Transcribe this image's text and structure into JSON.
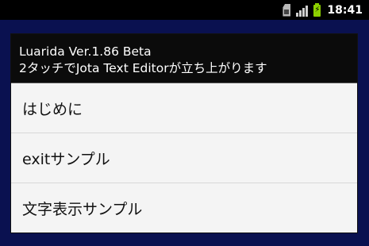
{
  "status_bar": {
    "time": "18:41",
    "icons": [
      "sim-card-icon",
      "signal-icon",
      "battery-charging-icon"
    ],
    "background": "#000000",
    "battery_color": "#8dd000"
  },
  "dialog": {
    "title_line1": "Luarida Ver.1.86 Beta",
    "title_line2": "2タッチでJota Text Editorが立ち上がります",
    "items": [
      {
        "label": "はじめに"
      },
      {
        "label": "exitサンプル"
      },
      {
        "label": "文字表示サンプル"
      }
    ]
  },
  "colors": {
    "background": "#0a1150",
    "dialog_header": "#0b0b0b",
    "dialog_body": "#f4f4f4"
  }
}
